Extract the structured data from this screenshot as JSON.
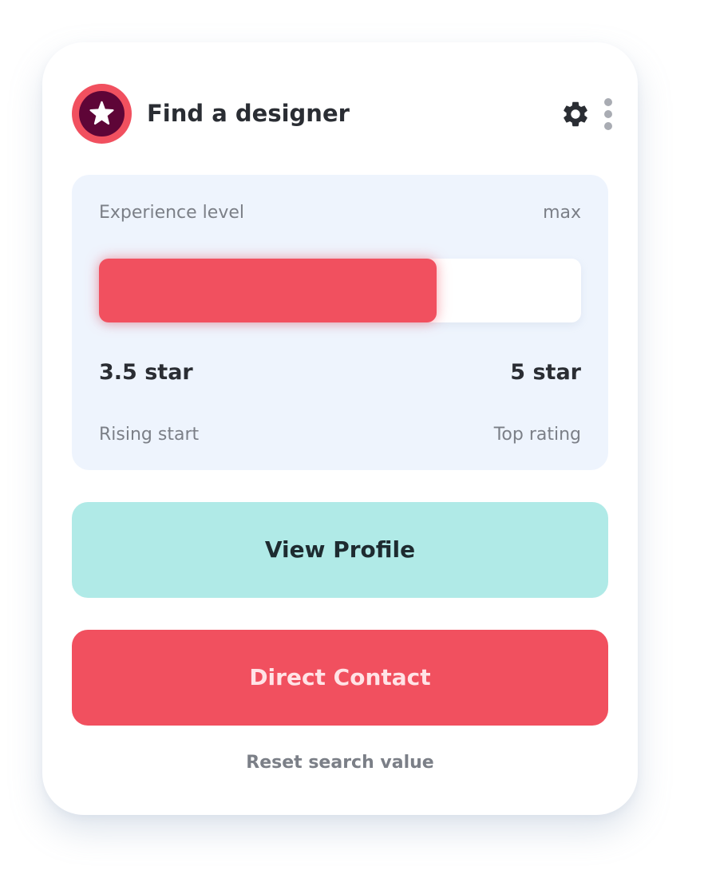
{
  "header": {
    "title": "Find a designer",
    "avatar_icon": "star-icon",
    "settings_icon": "gear-icon",
    "more_icon": "more-vertical-icon"
  },
  "experience": {
    "label": "Experience level",
    "max_label": "max",
    "current_value": "3.5 star",
    "max_value": "5 star",
    "fill_fraction": 0.7,
    "min_caption": "Rising start",
    "max_caption": "Top rating"
  },
  "actions": {
    "view_profile": "View Profile",
    "direct_contact": "Direct Contact",
    "reset": "Reset search value"
  },
  "colors": {
    "accent": "#f1505f",
    "avatar_dark": "#5e0537",
    "panel_bg": "#eef4fd",
    "view_button_bg": "#b0eae7"
  }
}
